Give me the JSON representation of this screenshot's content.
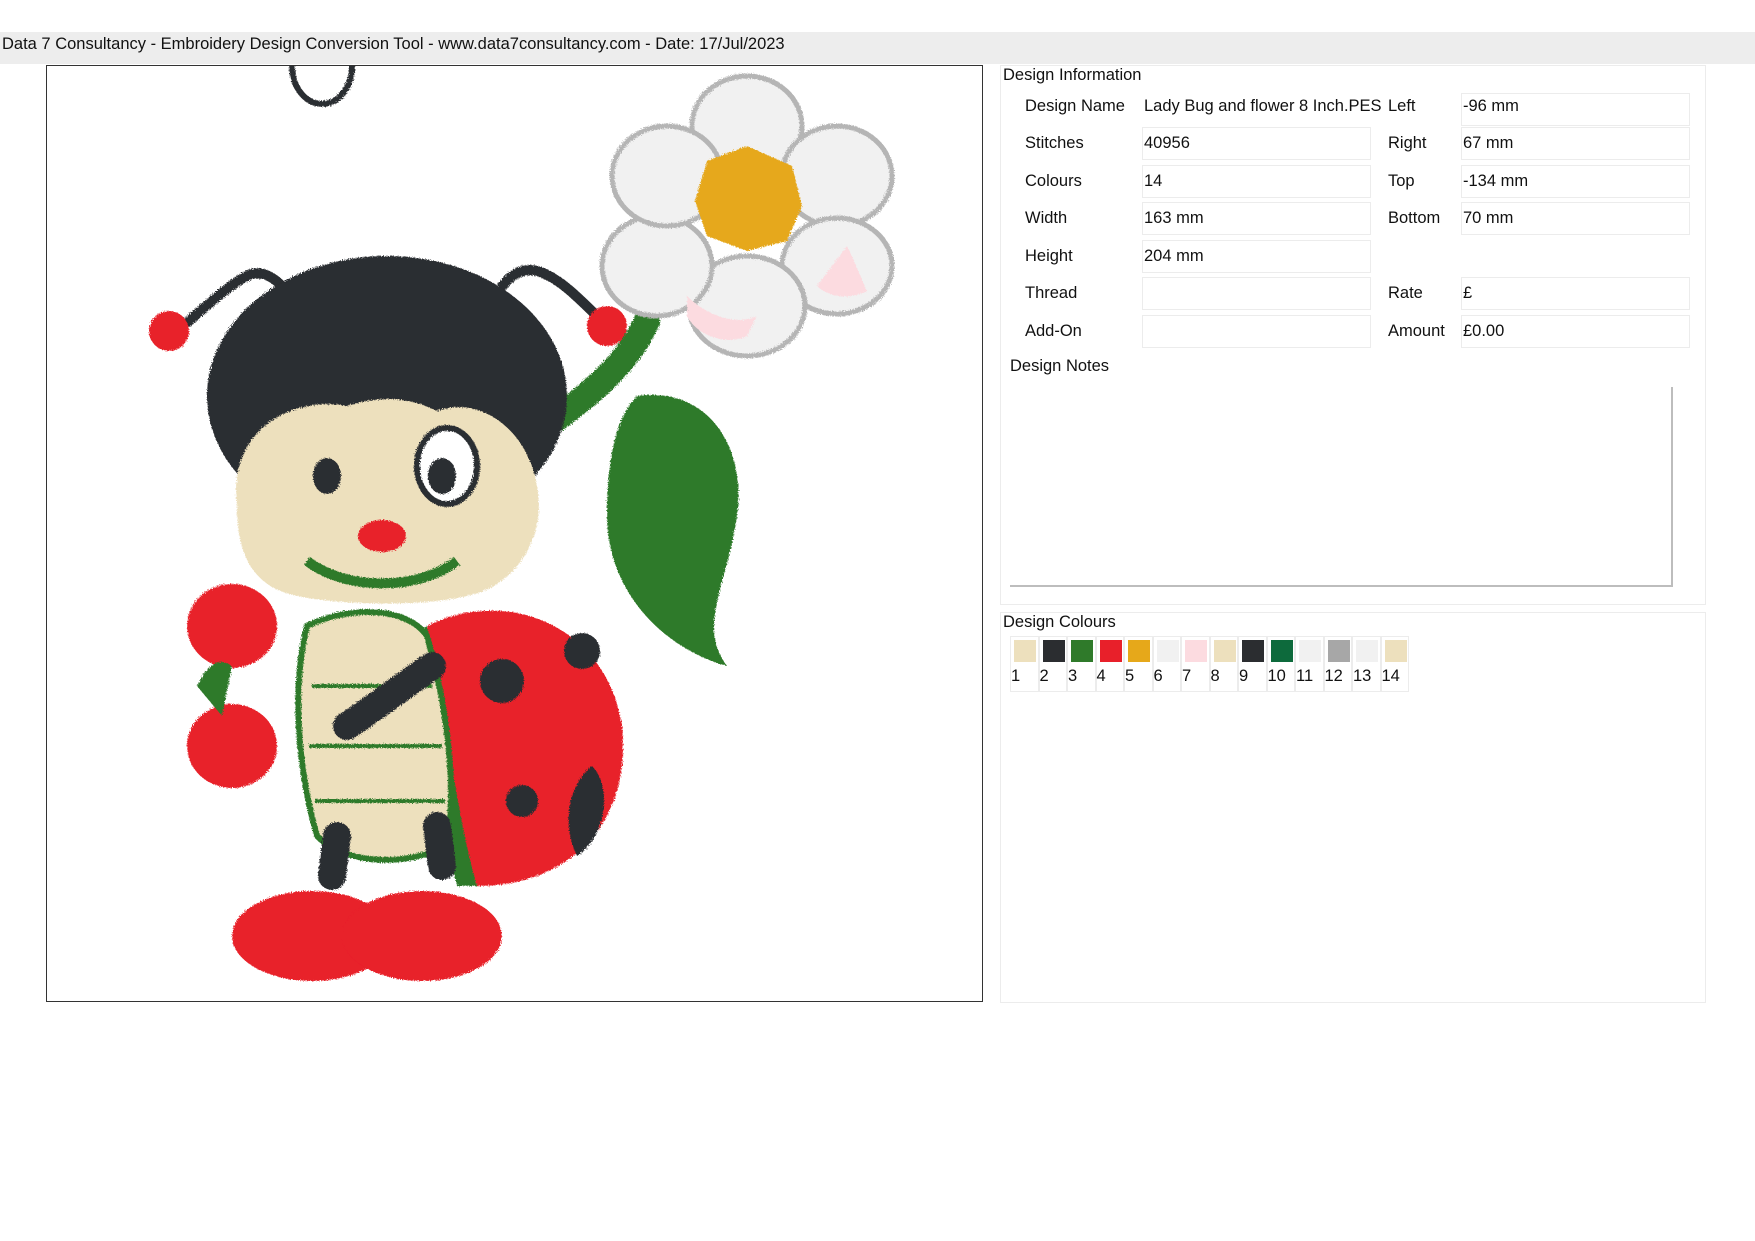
{
  "header": {
    "text": "Data 7 Consultancy - Embroidery Design Conversion Tool - www.data7consultancy.com - Date: 17/Jul/2023"
  },
  "design_info": {
    "title": "Design Information",
    "design_name_label": "Design Name",
    "design_name": "Lady Bug and flower 8 Inch.PES",
    "stitches_label": "Stitches",
    "stitches": "40956",
    "colours_label": "Colours",
    "colours": "14",
    "width_label": "Width",
    "width": "163 mm",
    "height_label": "Height",
    "height": "204 mm",
    "thread_label": "Thread",
    "thread": "",
    "addon_label": "Add-On",
    "addon": "",
    "left_label": "Left",
    "left": "-96 mm",
    "right_label": "Right",
    "right": "67 mm",
    "top_label": "Top",
    "top": "-134 mm",
    "bottom_label": "Bottom",
    "bottom": "70 mm",
    "rate_label": "Rate",
    "rate": "£",
    "amount_label": "Amount",
    "amount": "£0.00",
    "notes_label": "Design Notes",
    "notes": ""
  },
  "design_colours": {
    "title": "Design Colours",
    "swatches": [
      {
        "num": "1",
        "color": "#ede0bd"
      },
      {
        "num": "2",
        "color": "#2b2d30"
      },
      {
        "num": "3",
        "color": "#2f7a2a"
      },
      {
        "num": "4",
        "color": "#e8202a"
      },
      {
        "num": "5",
        "color": "#e6a81a"
      },
      {
        "num": "6",
        "color": "#f1f1f1"
      },
      {
        "num": "7",
        "color": "#fcdbe0"
      },
      {
        "num": "8",
        "color": "#ede0bd"
      },
      {
        "num": "9",
        "color": "#2b2d30"
      },
      {
        "num": "10",
        "color": "#0d6a3c"
      },
      {
        "num": "11",
        "color": "#f1f1f1"
      },
      {
        "num": "12",
        "color": "#a7a7a7"
      },
      {
        "num": "13",
        "color": "#f1f1f1"
      },
      {
        "num": "14",
        "color": "#ede0bd"
      }
    ]
  }
}
